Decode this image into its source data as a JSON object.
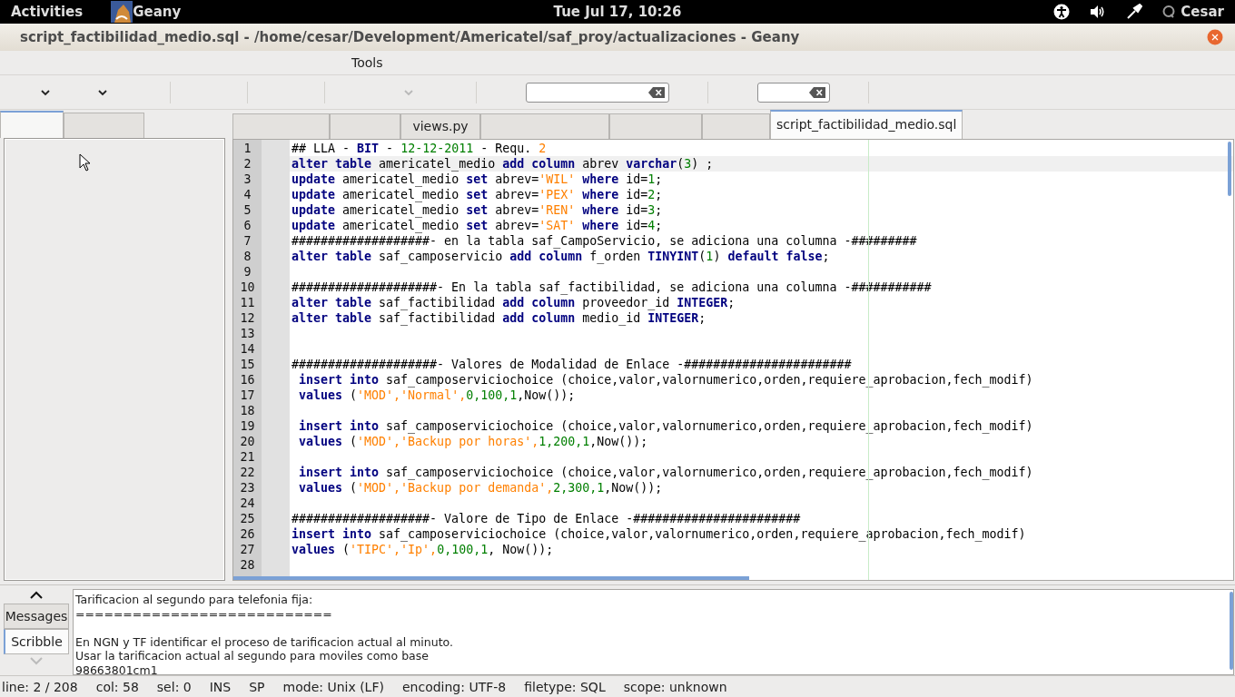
{
  "top_bar": {
    "activities": "Activities",
    "app_name": "Geany",
    "clock": "Tue Jul 17, 10:26",
    "user": "Cesar"
  },
  "window": {
    "title": "script_factibilidad_medio.sql - /home/cesar/Development/Americatel/saf_proy/actualizaciones - Geany"
  },
  "menu": [
    "Tools"
  ],
  "toolbar": {
    "items": [
      {
        "kind": "caret",
        "disabled": false
      },
      {
        "kind": "caret",
        "disabled": false
      },
      {
        "kind": "separator"
      },
      {
        "kind": "separator"
      },
      {
        "kind": "separator"
      },
      {
        "kind": "caret",
        "disabled": true
      },
      {
        "kind": "separator"
      },
      {
        "kind": "search"
      },
      {
        "kind": "separator"
      },
      {
        "kind": "goto"
      },
      {
        "kind": "separator"
      }
    ]
  },
  "sidebar": {
    "tabs": [
      {
        "selected": true
      },
      {
        "selected": false
      }
    ]
  },
  "editor": {
    "tabs": [
      {
        "selected": false
      },
      {
        "selected": false
      },
      {
        "label": "views.py",
        "selected": false
      },
      {
        "selected": false
      },
      {
        "selected": false
      },
      {
        "selected": false
      },
      {
        "label": "script_factibilidad_medio.sql",
        "selected": true
      }
    ],
    "lines": [
      {
        "number": "1",
        "current": false,
        "tokens": [
          {
            "kind": "plain",
            "text": "## LLA - "
          },
          {
            "kind": "keyword",
            "text": "BIT"
          },
          {
            "kind": "plain",
            "text": " - "
          },
          {
            "kind": "number",
            "text": "12-12-2011"
          },
          {
            "kind": "plain",
            "text": " - Requ. "
          },
          {
            "kind": "string",
            "text": "2"
          }
        ]
      },
      {
        "number": "2",
        "current": true,
        "tokens": [
          {
            "kind": "keyword",
            "text": "alter table"
          },
          {
            "kind": "plain",
            "text": " americatel_medio "
          },
          {
            "kind": "keyword",
            "text": "add column"
          },
          {
            "kind": "plain",
            "text": " abrev "
          },
          {
            "kind": "keyword",
            "text": "varchar"
          },
          {
            "kind": "plain",
            "text": "("
          },
          {
            "kind": "number",
            "text": "3"
          },
          {
            "kind": "plain",
            "text": ") ;"
          }
        ]
      },
      {
        "number": "3",
        "current": false,
        "tokens": [
          {
            "kind": "keyword",
            "text": "update"
          },
          {
            "kind": "plain",
            "text": " americatel_medio "
          },
          {
            "kind": "keyword",
            "text": "set"
          },
          {
            "kind": "plain",
            "text": " abrev="
          },
          {
            "kind": "string",
            "text": "'WIL'"
          },
          {
            "kind": "keyword",
            "text": " where"
          },
          {
            "kind": "plain",
            "text": " id="
          },
          {
            "kind": "number",
            "text": "1"
          },
          {
            "kind": "plain",
            "text": ";"
          }
        ]
      },
      {
        "number": "4",
        "current": false,
        "tokens": [
          {
            "kind": "keyword",
            "text": "update"
          },
          {
            "kind": "plain",
            "text": " americatel_medio "
          },
          {
            "kind": "keyword",
            "text": "set"
          },
          {
            "kind": "plain",
            "text": " abrev="
          },
          {
            "kind": "string",
            "text": "'PEX'"
          },
          {
            "kind": "keyword",
            "text": " where"
          },
          {
            "kind": "plain",
            "text": " id="
          },
          {
            "kind": "number",
            "text": "2"
          },
          {
            "kind": "plain",
            "text": ";"
          }
        ]
      },
      {
        "number": "5",
        "current": false,
        "tokens": [
          {
            "kind": "keyword",
            "text": "update"
          },
          {
            "kind": "plain",
            "text": " americatel_medio "
          },
          {
            "kind": "keyword",
            "text": "set"
          },
          {
            "kind": "plain",
            "text": " abrev="
          },
          {
            "kind": "string",
            "text": "'REN'"
          },
          {
            "kind": "keyword",
            "text": " where"
          },
          {
            "kind": "plain",
            "text": " id="
          },
          {
            "kind": "number",
            "text": "3"
          },
          {
            "kind": "plain",
            "text": ";"
          }
        ]
      },
      {
        "number": "6",
        "current": false,
        "tokens": [
          {
            "kind": "keyword",
            "text": "update"
          },
          {
            "kind": "plain",
            "text": " americatel_medio "
          },
          {
            "kind": "keyword",
            "text": "set"
          },
          {
            "kind": "plain",
            "text": " abrev="
          },
          {
            "kind": "string",
            "text": "'SAT'"
          },
          {
            "kind": "keyword",
            "text": " where"
          },
          {
            "kind": "plain",
            "text": " id="
          },
          {
            "kind": "number",
            "text": "4"
          },
          {
            "kind": "plain",
            "text": ";"
          }
        ]
      },
      {
        "number": "7",
        "current": false,
        "tokens": [
          {
            "kind": "plain",
            "text": "###################- en la tabla saf_CampoServicio, se adiciona una columna -#########"
          }
        ]
      },
      {
        "number": "8",
        "current": false,
        "tokens": [
          {
            "kind": "keyword",
            "text": "alter table"
          },
          {
            "kind": "plain",
            "text": " saf_camposervicio "
          },
          {
            "kind": "keyword",
            "text": "add column"
          },
          {
            "kind": "plain",
            "text": " f_orden "
          },
          {
            "kind": "keyword",
            "text": "TINYINT"
          },
          {
            "kind": "plain",
            "text": "("
          },
          {
            "kind": "number",
            "text": "1"
          },
          {
            "kind": "plain",
            "text": ") "
          },
          {
            "kind": "keyword",
            "text": "default false"
          },
          {
            "kind": "plain",
            "text": ";"
          }
        ]
      },
      {
        "number": "9",
        "current": false
      },
      {
        "number": "10",
        "current": false,
        "tokens": [
          {
            "kind": "plain",
            "text": "####################- En la tabla saf_factibilidad, se adiciona una columna -###########"
          }
        ]
      },
      {
        "number": "11",
        "current": false,
        "tokens": [
          {
            "kind": "keyword",
            "text": "alter table"
          },
          {
            "kind": "plain",
            "text": " saf_factibilidad "
          },
          {
            "kind": "keyword",
            "text": "add column"
          },
          {
            "kind": "plain",
            "text": " proveedor_id "
          },
          {
            "kind": "keyword",
            "text": "INTEGER"
          },
          {
            "kind": "plain",
            "text": ";"
          }
        ]
      },
      {
        "number": "12",
        "current": false,
        "tokens": [
          {
            "kind": "keyword",
            "text": "alter table"
          },
          {
            "kind": "plain",
            "text": " saf_factibilidad "
          },
          {
            "kind": "keyword",
            "text": "add column"
          },
          {
            "kind": "plain",
            "text": " medio_id "
          },
          {
            "kind": "keyword",
            "text": "INTEGER"
          },
          {
            "kind": "plain",
            "text": ";"
          }
        ]
      },
      {
        "number": "13",
        "current": false
      },
      {
        "number": "14",
        "current": false
      },
      {
        "number": "15",
        "current": false,
        "tokens": [
          {
            "kind": "plain",
            "text": "####################- Valores de Modalidad de Enlace -#######################"
          }
        ]
      },
      {
        "number": "16",
        "current": false,
        "tokens": [
          {
            "kind": "keyword",
            "text": " insert into"
          },
          {
            "kind": "plain",
            "text": " saf_camposerviciochoice (choice,valor,valornumerico,orden,requiere_aprobacion,fech_modif)"
          }
        ]
      },
      {
        "number": "17",
        "current": false,
        "tokens": [
          {
            "kind": "keyword",
            "text": " values"
          },
          {
            "kind": "plain",
            "text": " ("
          },
          {
            "kind": "string",
            "text": "'MOD','Normal',"
          },
          {
            "kind": "number",
            "text": "0,100,1"
          },
          {
            "kind": "plain",
            "text": ",Now());"
          }
        ]
      },
      {
        "number": "18",
        "current": false
      },
      {
        "number": "19",
        "current": false,
        "tokens": [
          {
            "kind": "keyword",
            "text": " insert into"
          },
          {
            "kind": "plain",
            "text": " saf_camposerviciochoice (choice,valor,valornumerico,orden,requiere_aprobacion,fech_modif)"
          }
        ]
      },
      {
        "number": "20",
        "current": false,
        "tokens": [
          {
            "kind": "keyword",
            "text": " values"
          },
          {
            "kind": "plain",
            "text": " ("
          },
          {
            "kind": "string",
            "text": "'MOD','Backup por horas',"
          },
          {
            "kind": "number",
            "text": "1,200,1"
          },
          {
            "kind": "plain",
            "text": ",Now());"
          }
        ]
      },
      {
        "number": "21",
        "current": false
      },
      {
        "number": "22",
        "current": false,
        "tokens": [
          {
            "kind": "keyword",
            "text": " insert into"
          },
          {
            "kind": "plain",
            "text": " saf_camposerviciochoice (choice,valor,valornumerico,orden,requiere_aprobacion,fech_modif)"
          }
        ]
      },
      {
        "number": "23",
        "current": false,
        "tokens": [
          {
            "kind": "keyword",
            "text": " values"
          },
          {
            "kind": "plain",
            "text": " ("
          },
          {
            "kind": "string",
            "text": "'MOD','Backup por demanda',"
          },
          {
            "kind": "number",
            "text": "2,300,1"
          },
          {
            "kind": "plain",
            "text": ",Now());"
          }
        ]
      },
      {
        "number": "24",
        "current": false
      },
      {
        "number": "25",
        "current": false,
        "tokens": [
          {
            "kind": "plain",
            "text": "###################- Valore de Tipo de Enlace -#######################"
          }
        ]
      },
      {
        "number": "26",
        "current": false,
        "tokens": [
          {
            "kind": "keyword",
            "text": "insert into"
          },
          {
            "kind": "plain",
            "text": " saf_camposerviciochoice (choice,valor,valornumerico,orden,requiere_aprobacion,fech_modif)"
          }
        ]
      },
      {
        "number": "27",
        "current": false,
        "tokens": [
          {
            "kind": "keyword",
            "text": "values"
          },
          {
            "kind": "plain",
            "text": " ("
          },
          {
            "kind": "string",
            "text": "'TIPC','Ip',"
          },
          {
            "kind": "number",
            "text": "0,100,1"
          },
          {
            "kind": "plain",
            "text": ", Now());"
          }
        ]
      },
      {
        "number": "28",
        "current": false
      }
    ]
  },
  "message_panel": {
    "tabs": [
      {
        "label": "Messages",
        "selected": false
      },
      {
        "label": "Scribble",
        "selected": true
      }
    ],
    "scribble": [
      {
        "text": "Tarificacion al segundo para telefonia fija:",
        "space_before": false
      },
      {
        "text": "===========================",
        "space_before": false
      },
      {
        "text": "En NGN y TF identificar el proceso de tarificacion actual al minuto.",
        "space_before": true
      },
      {
        "text": "Usar la tarificacion actual al segundo para moviles como base",
        "space_before": false
      },
      {
        "text": "98663801cm1",
        "space_before": false
      }
    ]
  },
  "status_bar": [
    "line: 2 / 208",
    "col: 58",
    "sel: 0",
    "INS",
    "SP",
    "mode: Unix (LF)",
    "encoding: UTF-8",
    "filetype: SQL",
    "scope: unknown"
  ]
}
